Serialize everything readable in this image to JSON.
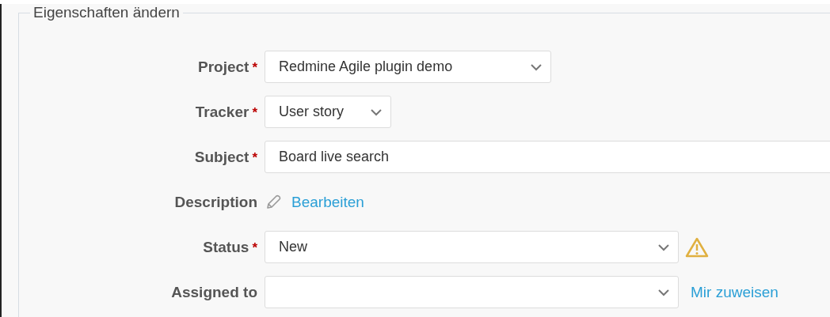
{
  "fieldset": {
    "legend": "Eigenschaften ändern"
  },
  "fields": [
    {
      "label": "Project",
      "required_mark": "*",
      "kind": "select",
      "value": "Redmine Agile plugin demo"
    },
    {
      "label": "Tracker",
      "required_mark": "*",
      "kind": "select",
      "value": "User story"
    },
    {
      "label": "Subject",
      "required_mark": "*",
      "kind": "text",
      "value": "Board live search"
    },
    {
      "label": "Description",
      "kind": "edit-link",
      "link": "Bearbeiten"
    },
    {
      "label": "Status",
      "required_mark": "*",
      "kind": "select",
      "value": "New",
      "warning": true
    },
    {
      "label": "Assigned to",
      "kind": "select",
      "link": "Mir zuweisen"
    }
  ]
}
